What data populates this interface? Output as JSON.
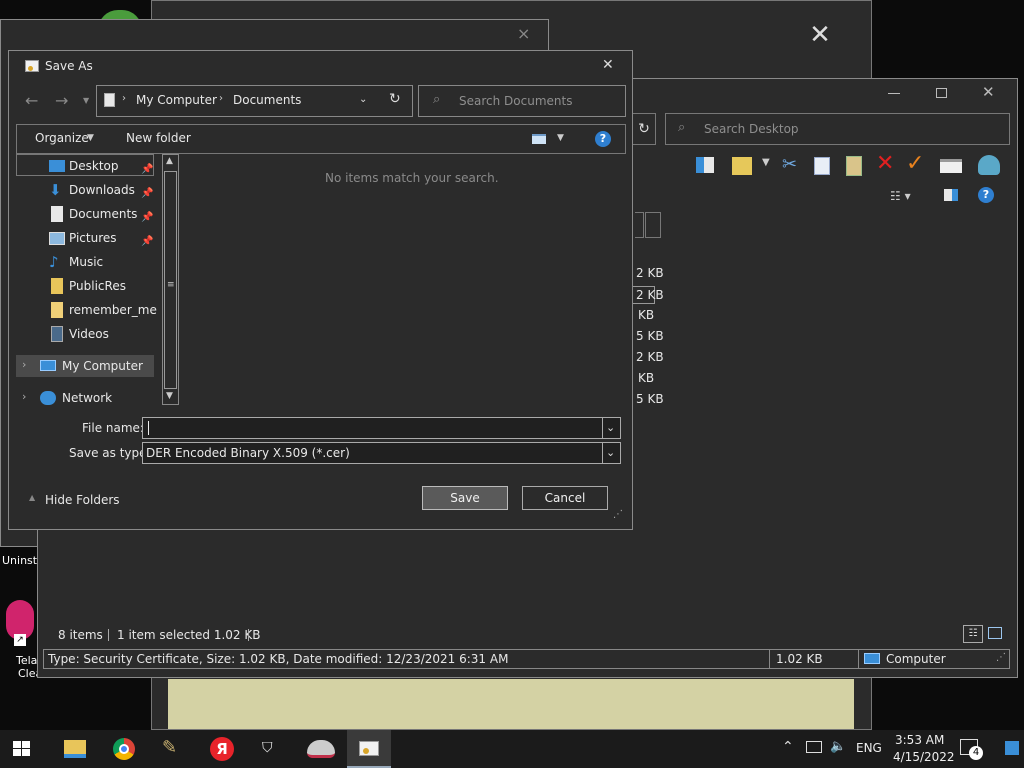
{
  "desktop": {
    "left_labels": [
      "Uninst",
      "Tela",
      "Clean"
    ]
  },
  "back_dialog": {
    "close_label": "×",
    "big_close": "✕"
  },
  "explorer": {
    "search_placeholder": "Search Desktop",
    "status": {
      "items": "8 items",
      "selected": "1 item selected  1.02 KB"
    },
    "details_bar": {
      "info": "Type: Security Certificate, Size: 1.02 KB, Date modified: 12/23/2021 6:31 AM",
      "size": "1.02 KB",
      "location": "Computer"
    },
    "sizes": [
      "2 KB",
      "2 KB",
      "KB",
      "5 KB",
      "2 KB",
      "KB",
      "5 KB"
    ]
  },
  "saveas": {
    "title": "Save As",
    "breadcrumb": [
      "My Computer",
      "Documents"
    ],
    "search_placeholder": "Search Documents",
    "organize_label": "Organize",
    "new_folder_label": "New folder",
    "empty_message": "No items match your search.",
    "nav": {
      "quick_access": [
        {
          "label": "Desktop",
          "pinned": true
        },
        {
          "label": "Downloads",
          "pinned": true
        },
        {
          "label": "Documents",
          "pinned": true
        },
        {
          "label": "Pictures",
          "pinned": true
        },
        {
          "label": "Music",
          "pinned": false
        },
        {
          "label": "PublicRes",
          "pinned": false
        },
        {
          "label": "remember_me",
          "pinned": false
        },
        {
          "label": "Videos",
          "pinned": false
        }
      ],
      "my_computer": "My Computer",
      "network": "Network"
    },
    "file_name_label": "File name:",
    "file_name_value": "",
    "save_type_label": "Save as type:",
    "save_type_value": "DER Encoded Binary X.509 (*.cer)",
    "hide_folders_label": "Hide Folders",
    "save_label": "Save",
    "cancel_label": "Cancel"
  },
  "taskbar": {
    "time": "3:53 AM",
    "date": "4/15/2022",
    "language": "ENG",
    "notification_count": "4"
  },
  "colors": {
    "dialog_bg": "#2b2b2b",
    "panel_bg": "#202020",
    "accent": "#3a8fd8",
    "khaki": "#d4d2a4",
    "taskbar": "#1b1b1b"
  }
}
